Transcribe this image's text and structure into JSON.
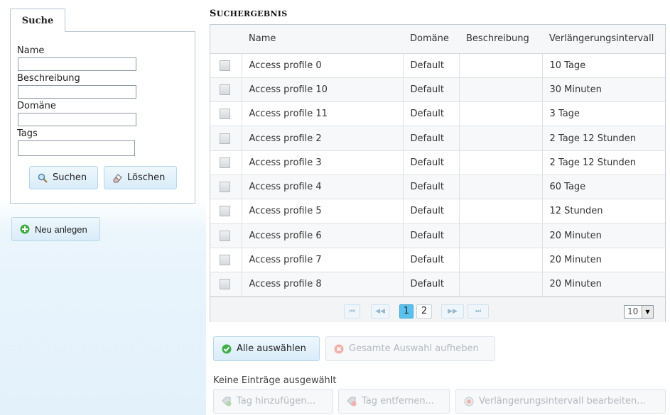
{
  "search": {
    "tab_label": "Suche",
    "fields": [
      {
        "label": "Name",
        "value": ""
      },
      {
        "label": "Beschreibung",
        "value": ""
      },
      {
        "label": "Domäne",
        "value": ""
      },
      {
        "label": "Tags",
        "value": ""
      }
    ],
    "search_button": "Suchen",
    "clear_button": "Löschen"
  },
  "new_button": "Neu anlegen",
  "results": {
    "title_first": "S",
    "title_rest": "UCHERGEBNIS",
    "columns": [
      "Name",
      "Domäne",
      "Beschreibung",
      "Verlängerungsintervall"
    ],
    "rows": [
      {
        "name": "Access profile 0",
        "domain": "Default",
        "description": "",
        "interval": "10 Tage"
      },
      {
        "name": "Access profile 10",
        "domain": "Default",
        "description": "",
        "interval": "30 Minuten"
      },
      {
        "name": "Access profile 11",
        "domain": "Default",
        "description": "",
        "interval": "3 Tage"
      },
      {
        "name": "Access profile 2",
        "domain": "Default",
        "description": "",
        "interval": "2 Tage 12 Stunden"
      },
      {
        "name": "Access profile 3",
        "domain": "Default",
        "description": "",
        "interval": "2 Tage 12 Stunden"
      },
      {
        "name": "Access profile 4",
        "domain": "Default",
        "description": "",
        "interval": "60 Tage"
      },
      {
        "name": "Access profile 5",
        "domain": "Default",
        "description": "",
        "interval": "12 Stunden"
      },
      {
        "name": "Access profile 6",
        "domain": "Default",
        "description": "",
        "interval": "20 Minuten"
      },
      {
        "name": "Access profile 7",
        "domain": "Default",
        "description": "",
        "interval": "20 Minuten"
      },
      {
        "name": "Access profile 8",
        "domain": "Default",
        "description": "",
        "interval": "20 Minuten"
      }
    ],
    "pager": {
      "first": "⏮",
      "prev": "◀◀",
      "next": "▶▶",
      "last": "⏭",
      "pages": [
        "1",
        "2"
      ],
      "current_page": "1",
      "page_size": "10"
    }
  },
  "actions": {
    "select_all": "Alle auswählen",
    "deselect_all": "Gesamte Auswahl aufheben",
    "status": "Keine Einträge ausgewählt",
    "add_tag": "Tag hinzufügen...",
    "remove_tag": "Tag entfernen...",
    "edit_interval": "Verlängerungsintervall bearbeiten..."
  },
  "colors": {
    "accent": "#5cc0ec",
    "panel_bg": "#e3f1fb",
    "button_bg": "#d9ecf9"
  }
}
